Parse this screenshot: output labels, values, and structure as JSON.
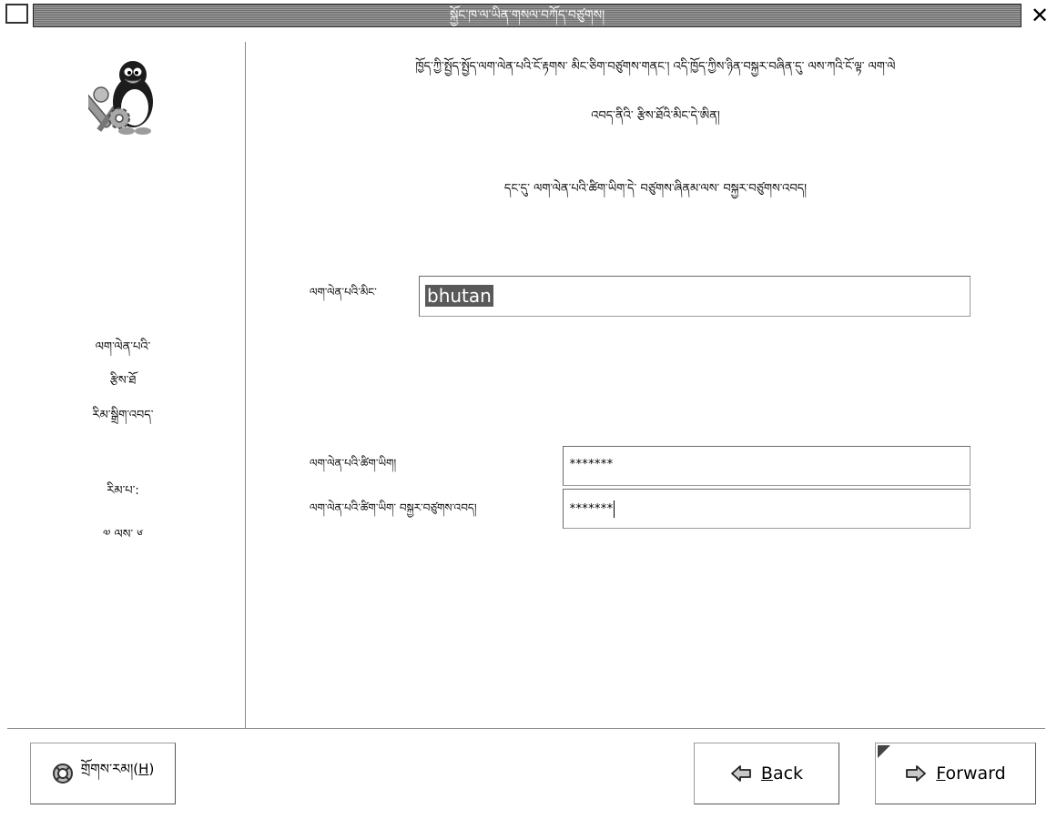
{
  "window": {
    "title": "སྐྱོང་ཁ་ལ་ཡིན་གསལ་བཀོད་བཙུགས།"
  },
  "side": {
    "steps": [
      "ལག་ལེན་པའི་",
      "རྩིས་ཐོ",
      "རིམ་སྒྲིག་འབད་",
      "རིམ་པ་:",
      "༧ ལས་ ༦"
    ]
  },
  "main": {
    "intro_line1": "ཁྱོད་ཀྱི་སྤྱོད་སྤྱོད་ལག་ལེན་པའི་ངོ་རྟགས་ མིང་ཅིག་བཙུགས་གནང་། འདི་ཁྱོད་ཀྱིས་ཉིན་བསྐྱར་བཞིན་དུ་ ལས་ཀའི་ངོ་ལྟ་ ལག་ལེ",
    "intro_line2": "འབད་ནིའི་ རྩིས་ཐོའི་མིང་དེ་ཨིན།",
    "intro_line3": "དང་དུ་ ལག་ལེན་པའི་ཚིག་ཡིག་དེ་ བཙུགས་ཞིནམ་ལས་ བསྐྱར་བཙུགས་འབད།",
    "username_label": "ལག་ལེན་པའི་མིང་",
    "username_value": "bhutan",
    "password_label": "ལག་ལེན་པའི་ཚིག་ཡིག།",
    "password_value": "*******",
    "confirm_label": "ལག་ལེན་པའི་ཚིག་ཡིག་ བསྐྱར་བཙུགས་འབད།",
    "confirm_value": "*******"
  },
  "buttons": {
    "help_label": "གྲོགས་རམ།(",
    "help_mnemonic": "H",
    "help_suffix": ")",
    "back_mnemonic": "B",
    "back_rest": "ack",
    "forward_mnemonic": "F",
    "forward_rest": "orward"
  },
  "icons": {
    "help": "help-lifebuoy-icon",
    "back": "arrow-left-icon",
    "forward": "arrow-right-icon",
    "logo": "tux-tools-icon"
  }
}
